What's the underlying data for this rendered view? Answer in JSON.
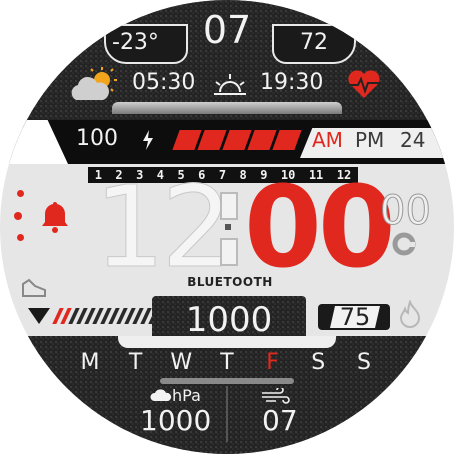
{
  "colors": {
    "accent": "#e0281e",
    "dark": "#232323",
    "light": "#f2f2f2"
  },
  "top": {
    "temp_low": "-23°",
    "day": "07",
    "temp_high": "72",
    "weather_icon": "partly-cloudy-icon",
    "sunrise": "05:30",
    "sunrise_icon": "sunrise-icon",
    "sunset": "19:30",
    "heart_icon": "heart-rate-icon"
  },
  "battery": {
    "value": "100",
    "charge_icon": "lightning-icon",
    "level_fraction": 1.0,
    "segments": 5
  },
  "time_format": {
    "am": "AM",
    "pm": "PM",
    "h24": "24",
    "active": "AM"
  },
  "hour_ruler": [
    "1",
    "2",
    "3",
    "4",
    "5",
    "6",
    "7",
    "8",
    "9",
    "10",
    "11",
    "12"
  ],
  "time": {
    "hours": "12",
    "minutes": "00",
    "seconds": "00",
    "bluetooth_label": "BLUETOOTH"
  },
  "steps": {
    "value": "1000",
    "icon": "shoe-icon"
  },
  "calories": {
    "value": "75",
    "icon": "flame-icon"
  },
  "weekdays": {
    "items": [
      "M",
      "T",
      "W",
      "T",
      "F",
      "S",
      "S"
    ],
    "active_index": 4
  },
  "bottom": {
    "pressure_unit": "hPa",
    "pressure_value": "1000",
    "wind_value": "07"
  }
}
